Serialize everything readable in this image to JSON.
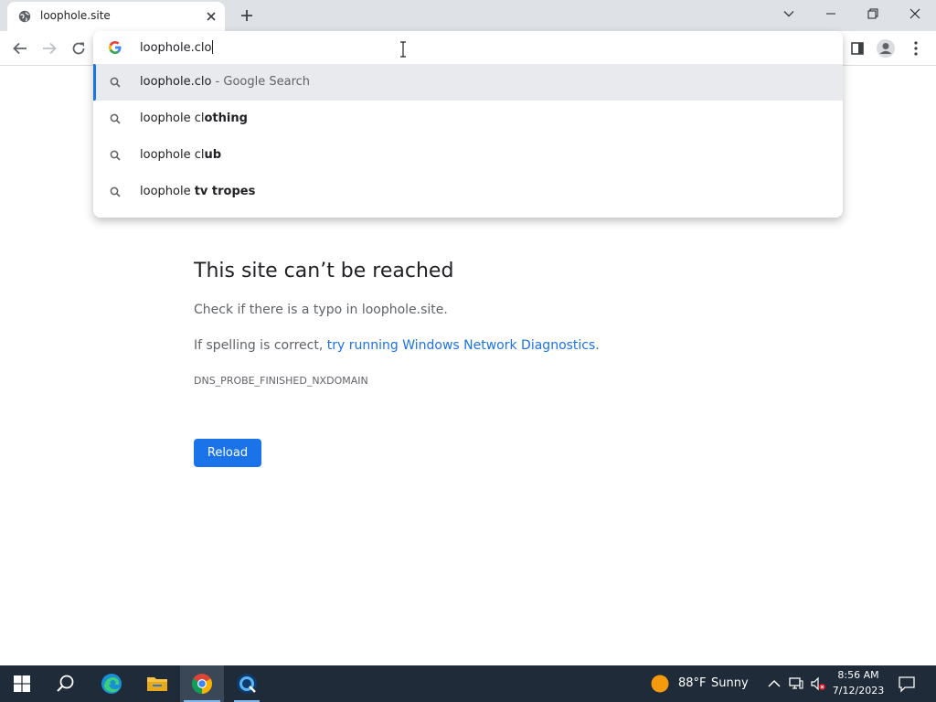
{
  "browser": {
    "tab": {
      "title": "loophole.site"
    },
    "omnibox": {
      "typed": "loophole.clo",
      "suggestions": [
        {
          "prefix": "loophole.clo",
          "rest": "",
          "suffix": " - Google Search",
          "selected": true
        },
        {
          "prefix": "loophole cl",
          "rest": "othing",
          "suffix": "",
          "selected": false
        },
        {
          "prefix": "loophole cl",
          "rest": "ub",
          "suffix": "",
          "selected": false
        },
        {
          "prefix": "loophole ",
          "rest": "tv tropes",
          "suffix": "",
          "selected": false
        }
      ]
    }
  },
  "error_page": {
    "title": "This site can’t be reached",
    "line1": "Check if there is a typo in loophole.site.",
    "line2_prefix": "If spelling is correct, ",
    "line2_link": "try running Windows Network Diagnostics",
    "line2_suffix": ".",
    "code": "DNS_PROBE_FINISHED_NXDOMAIN",
    "reload_label": "Reload"
  },
  "taskbar": {
    "weather_temp": "88°F",
    "weather_condition": "Sunny",
    "clock_time": "8:56 AM",
    "clock_date": "7/12/2023"
  },
  "colors": {
    "accent": "#1a73e8",
    "tabstrip": "#dee1e6",
    "taskbar": "#1f2b38"
  },
  "icons": {
    "tab": [
      "globe-icon",
      "close-icon",
      "plus-icon"
    ],
    "window": [
      "tab-search-icon",
      "minimize-icon",
      "restore-icon",
      "close-icon"
    ],
    "toolbar": [
      "back-icon",
      "forward-icon",
      "reload-icon",
      "google-icon",
      "side-panel-icon",
      "profile-icon",
      "menu-icon"
    ],
    "taskbar": [
      "windows-start-icon",
      "search-icon",
      "edge-icon",
      "file-explorer-icon",
      "chrome-icon",
      "app-icon",
      "sun-icon",
      "chevron-up-icon",
      "network-icon",
      "volume-muted-icon",
      "notification-icon"
    ]
  }
}
